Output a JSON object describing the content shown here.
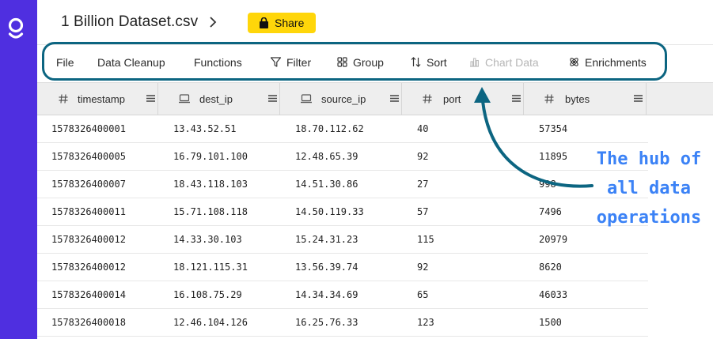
{
  "file": {
    "title": "1 Billion Dataset.csv",
    "share_label": "Share"
  },
  "toolbar": [
    {
      "label": "File",
      "icon": ""
    },
    {
      "label": "Data Cleanup",
      "icon": ""
    },
    {
      "label": "Functions",
      "icon": ""
    },
    {
      "label": "Filter",
      "icon": "filter-icon"
    },
    {
      "label": "Group",
      "icon": "group-icon"
    },
    {
      "label": "Sort",
      "icon": "sort-icon"
    },
    {
      "label": "Chart Data",
      "icon": "chart-icon",
      "disabled": true
    },
    {
      "label": "Enrichments",
      "icon": "enrichments-icon"
    }
  ],
  "columns": [
    {
      "name": "timestamp",
      "icon": "hash-icon"
    },
    {
      "name": "dest_ip",
      "icon": "ip-icon"
    },
    {
      "name": "source_ip",
      "icon": "ip-icon"
    },
    {
      "name": "port",
      "icon": "hash-icon"
    },
    {
      "name": "bytes",
      "icon": "hash-icon"
    }
  ],
  "rows": [
    [
      "1578326400001",
      "13.43.52.51",
      "18.70.112.62",
      "40",
      "57354"
    ],
    [
      "1578326400005",
      "16.79.101.100",
      "12.48.65.39",
      "92",
      "11895"
    ],
    [
      "1578326400007",
      "18.43.118.103",
      "14.51.30.86",
      "27",
      "998"
    ],
    [
      "1578326400011",
      "15.71.108.118",
      "14.50.119.33",
      "57",
      "7496"
    ],
    [
      "1578326400012",
      "14.33.30.103",
      "15.24.31.23",
      "115",
      "20979"
    ],
    [
      "1578326400012",
      "18.121.115.31",
      "13.56.39.74",
      "92",
      "8620"
    ],
    [
      "1578326400014",
      "16.108.75.29",
      "14.34.34.69",
      "65",
      "46033"
    ],
    [
      "1578326400018",
      "12.46.104.126",
      "16.25.76.33",
      "123",
      "1500"
    ]
  ],
  "annotation": {
    "lines": [
      "The hub of",
      "all data",
      "operations"
    ],
    "color": "#3b82f6",
    "outline_color": "#0c6581"
  },
  "colors": {
    "sidebar": "#4f2fe0",
    "share": "#ffd60a"
  }
}
